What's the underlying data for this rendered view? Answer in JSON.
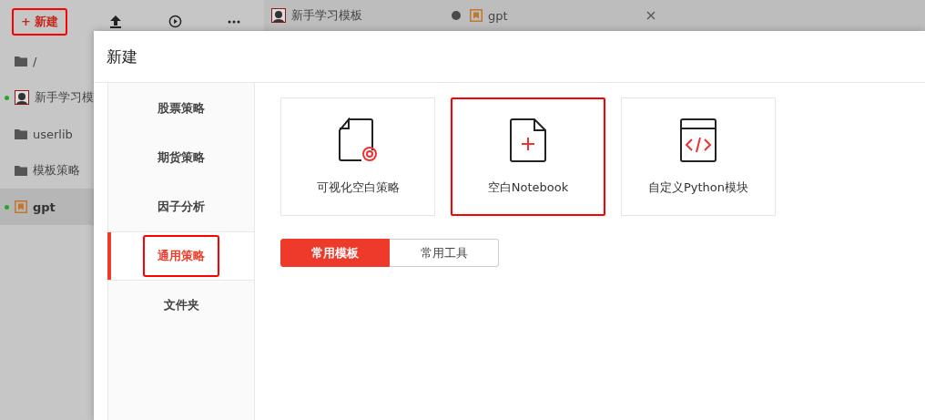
{
  "toolbar": {
    "new_button": {
      "label": "+ 新建",
      "annotated": true
    }
  },
  "file_tree": [
    {
      "label": "/",
      "kind": "folder",
      "running": false,
      "selected": false
    },
    {
      "label": "新手学习模",
      "kind": "avatar",
      "running": true,
      "selected": false
    },
    {
      "label": "userlib",
      "kind": "folder",
      "running": false,
      "selected": false
    },
    {
      "label": "模板策略",
      "kind": "folder",
      "running": false,
      "selected": false
    },
    {
      "label": "gpt",
      "kind": "notebook",
      "running": true,
      "selected": true
    }
  ],
  "tabs": [
    {
      "label": "新手学习模板",
      "kind": "avatar",
      "modified": true
    },
    {
      "label": "gpt",
      "kind": "notebook",
      "modified": false
    }
  ],
  "dialog": {
    "title": "新建",
    "categories": [
      {
        "label": "股票策略",
        "selected": false,
        "annotated": false
      },
      {
        "label": "期货策略",
        "selected": false,
        "annotated": false
      },
      {
        "label": "因子分析",
        "selected": false,
        "annotated": false
      },
      {
        "label": "通用策略",
        "selected": true,
        "annotated": true
      },
      {
        "label": "文件夹",
        "selected": false,
        "annotated": false
      }
    ],
    "cards": [
      {
        "label": "可视化空白策略",
        "kind": "visual",
        "annotated": false
      },
      {
        "label": "空白Notebook",
        "kind": "notebook",
        "annotated": true
      },
      {
        "label": "自定义Python模块",
        "kind": "python",
        "annotated": false
      }
    ],
    "segments": [
      {
        "label": "常用模板",
        "selected": true
      },
      {
        "label": "常用工具",
        "selected": false
      }
    ]
  }
}
